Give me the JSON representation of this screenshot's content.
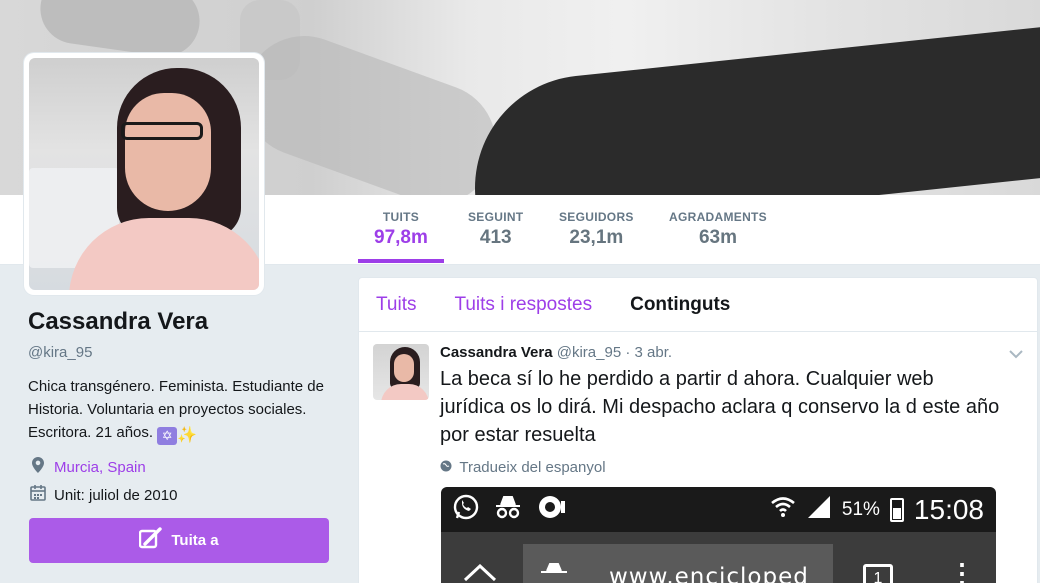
{
  "stats": [
    {
      "label": "TUITS",
      "value": "97,8m",
      "active": true
    },
    {
      "label": "SEGUINT",
      "value": "413",
      "active": false
    },
    {
      "label": "SEGUIDORS",
      "value": "23,1m",
      "active": false
    },
    {
      "label": "AGRADAMENTS",
      "value": "63m",
      "active": false
    }
  ],
  "profile": {
    "name": "Cassandra Vera",
    "handle": "@kira_95",
    "bio": "Chica transgénero. Feminista. Estudiante de Historia. Voluntaria en proyectos sociales. Escritora. 21 años.",
    "location": "Murcia, Spain",
    "joined": "Unit: juliol de 2010",
    "tweet_to_label": "Tuita a"
  },
  "tabs": [
    {
      "label": "Tuits",
      "active": false
    },
    {
      "label": "Tuits i respostes",
      "active": false
    },
    {
      "label": "Continguts",
      "active": true
    }
  ],
  "tweet": {
    "name": "Cassandra Vera",
    "handle": "@kira_95",
    "date": "· 3 abr.",
    "text": "La beca sí lo he perdido a partir d ahora. Cualquier web jurídica os lo dirá. Mi despacho aclara q conservo la d este año por estar resuelta",
    "translate": "Tradueix del espanyol"
  },
  "media": {
    "battery_pct": "51%",
    "clock": "15:08",
    "url": "www.encicloped",
    "tabs_count": "1"
  },
  "icons": {
    "location": "map-pin-icon",
    "calendar": "calendar-icon",
    "feather": "compose-icon",
    "globe": "globe-icon",
    "chevron": "chevron-down-icon"
  },
  "colors": {
    "accent": "#9d3ee8",
    "button": "#ab5be8"
  }
}
